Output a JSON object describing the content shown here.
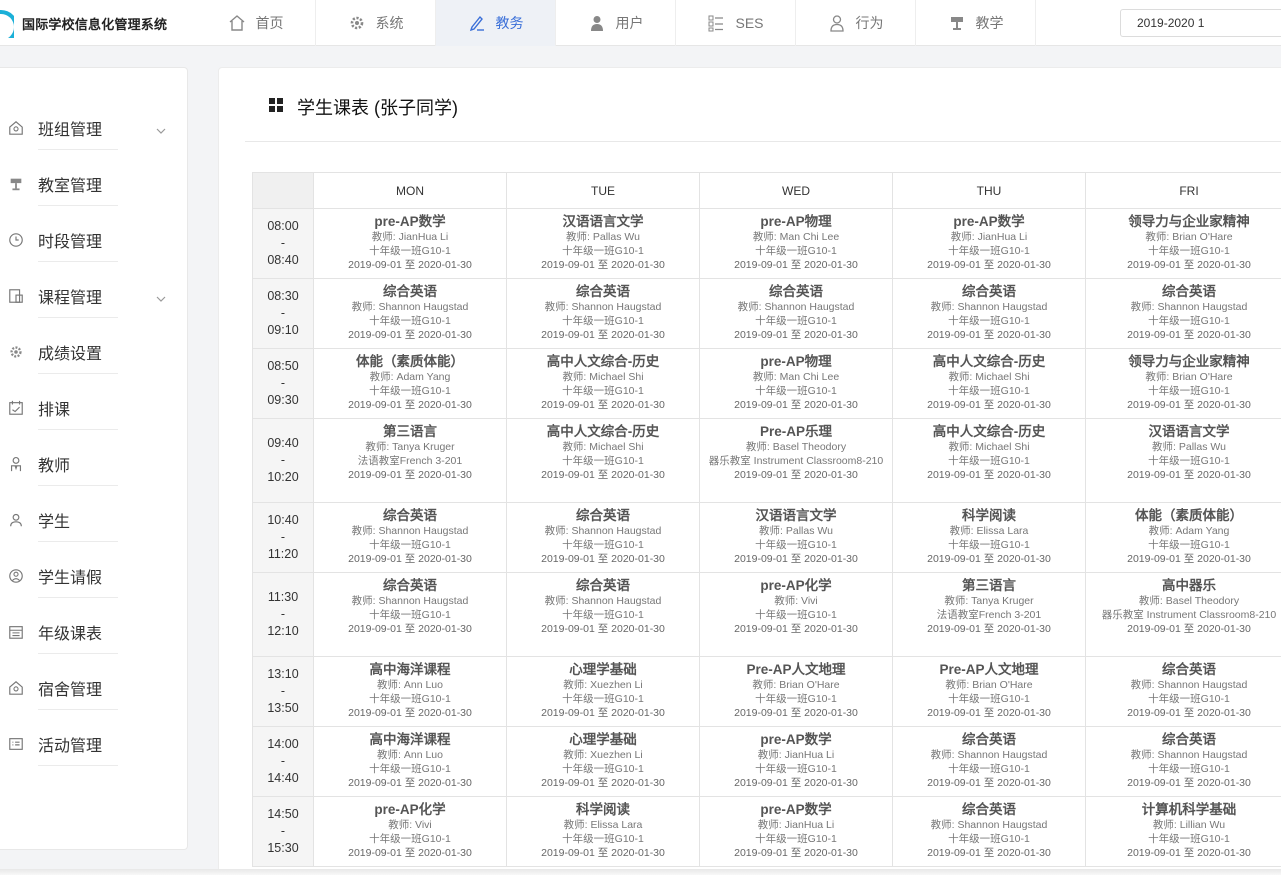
{
  "app": {
    "title": "国际学校信息化管理系统"
  },
  "nav": [
    {
      "label": "首页",
      "icon": "home-icon",
      "active": false
    },
    {
      "label": "系统",
      "icon": "gear-icon",
      "active": false
    },
    {
      "label": "教务",
      "icon": "pen-icon",
      "active": true
    },
    {
      "label": "用户",
      "icon": "user-icon",
      "active": false
    },
    {
      "label": "SES",
      "icon": "checklist-icon",
      "active": false
    },
    {
      "label": "行为",
      "icon": "person-outline-icon",
      "active": false
    },
    {
      "label": "教学",
      "icon": "lamp-icon",
      "active": false
    }
  ],
  "term": {
    "value": "2019-2020 1"
  },
  "sidebar": [
    {
      "label": "班组管理",
      "icon": "home-outline-icon",
      "chevron": true
    },
    {
      "label": "教室管理",
      "icon": "lamp-icon",
      "chevron": false
    },
    {
      "label": "时段管理",
      "icon": "clock-icon",
      "chevron": false
    },
    {
      "label": "课程管理",
      "icon": "book-icon",
      "chevron": true
    },
    {
      "label": "成绩设置",
      "icon": "gear-icon",
      "chevron": false
    },
    {
      "label": "排课",
      "icon": "calendar-icon",
      "chevron": false
    },
    {
      "label": "教师",
      "icon": "teacher-icon",
      "chevron": false
    },
    {
      "label": "学生",
      "icon": "student-icon",
      "chevron": false
    },
    {
      "label": "学生请假",
      "icon": "leave-icon",
      "chevron": false
    },
    {
      "label": "年级课表",
      "icon": "schedule-icon",
      "chevron": false
    },
    {
      "label": "宿舍管理",
      "icon": "dorm-icon",
      "chevron": false
    },
    {
      "label": "活动管理",
      "icon": "activity-icon",
      "chevron": false
    }
  ],
  "card": {
    "title": "学生课表 (张子同学)"
  },
  "timetable": {
    "days": [
      "MON",
      "TUE",
      "WED",
      "THU",
      "FRI"
    ],
    "rows": [
      {
        "start": "08:00",
        "sep": "-",
        "end": "08:40",
        "cells": [
          {
            "name": "pre-AP数学",
            "teacher": "教师: JianHua Li",
            "room": "十年级一班G10-1",
            "date": "2019-09-01 至 2020-01-30"
          },
          {
            "name": "汉语语言文学",
            "teacher": "教师: Pallas Wu",
            "room": "十年级一班G10-1",
            "date": "2019-09-01 至 2020-01-30"
          },
          {
            "name": "pre-AP物理",
            "teacher": "教师: Man Chi Lee",
            "room": "十年级一班G10-1",
            "date": "2019-09-01 至 2020-01-30"
          },
          {
            "name": "pre-AP数学",
            "teacher": "教师: JianHua Li",
            "room": "十年级一班G10-1",
            "date": "2019-09-01 至 2020-01-30"
          },
          {
            "name": "领导力与企业家精神",
            "teacher": "教师: Brian O'Hare",
            "room": "十年级一班G10-1",
            "date": "2019-09-01 至 2020-01-30"
          }
        ]
      },
      {
        "start": "08:30",
        "sep": "-",
        "end": "09:10",
        "cells": [
          {
            "name": "综合英语",
            "teacher": "教师: Shannon Haugstad",
            "room": "十年级一班G10-1",
            "date": "2019-09-01 至 2020-01-30"
          },
          {
            "name": "综合英语",
            "teacher": "教师: Shannon Haugstad",
            "room": "十年级一班G10-1",
            "date": "2019-09-01 至 2020-01-30"
          },
          {
            "name": "综合英语",
            "teacher": "教师: Shannon Haugstad",
            "room": "十年级一班G10-1",
            "date": "2019-09-01 至 2020-01-30"
          },
          {
            "name": "综合英语",
            "teacher": "教师: Shannon Haugstad",
            "room": "十年级一班G10-1",
            "date": "2019-09-01 至 2020-01-30"
          },
          {
            "name": "综合英语",
            "teacher": "教师: Shannon Haugstad",
            "room": "十年级一班G10-1",
            "date": "2019-09-01 至 2020-01-30"
          }
        ]
      },
      {
        "start": "08:50",
        "sep": "-",
        "end": "09:30",
        "cells": [
          {
            "name": "体能（素质体能）",
            "teacher": "教师: Adam Yang",
            "room": "十年级一班G10-1",
            "date": "2019-09-01 至 2020-01-30"
          },
          {
            "name": "高中人文综合-历史",
            "teacher": "教师: Michael Shi",
            "room": "十年级一班G10-1",
            "date": "2019-09-01 至 2020-01-30"
          },
          {
            "name": "pre-AP物理",
            "teacher": "教师: Man Chi Lee",
            "room": "十年级一班G10-1",
            "date": "2019-09-01 至 2020-01-30"
          },
          {
            "name": "高中人文综合-历史",
            "teacher": "教师: Michael Shi",
            "room": "十年级一班G10-1",
            "date": "2019-09-01 至 2020-01-30"
          },
          {
            "name": "领导力与企业家精神",
            "teacher": "教师: Brian O'Hare",
            "room": "十年级一班G10-1",
            "date": "2019-09-01 至 2020-01-30"
          }
        ]
      },
      {
        "start": "09:40",
        "sep": "-",
        "end": "10:20",
        "cells": [
          {
            "name": "第三语言",
            "teacher": "教师: Tanya Kruger",
            "room": "法语教室French 3-201",
            "date": "2019-09-01 至 2020-01-30"
          },
          {
            "name": "高中人文综合-历史",
            "teacher": "教师: Michael Shi",
            "room": "十年级一班G10-1",
            "date": "2019-09-01 至 2020-01-30"
          },
          {
            "name": "Pre-AP乐理",
            "teacher": "教师: Basel Theodory",
            "room": "器乐教室 Instrument Classroom8-210",
            "date": "2019-09-01 至 2020-01-30"
          },
          {
            "name": "高中人文综合-历史",
            "teacher": "教师: Michael Shi",
            "room": "十年级一班G10-1",
            "date": "2019-09-01 至 2020-01-30"
          },
          {
            "name": "汉语语言文学",
            "teacher": "教师: Pallas Wu",
            "room": "十年级一班G10-1",
            "date": "2019-09-01 至 2020-01-30"
          }
        ]
      },
      {
        "start": "10:40",
        "sep": "-",
        "end": "11:20",
        "cells": [
          {
            "name": "综合英语",
            "teacher": "教师: Shannon Haugstad",
            "room": "十年级一班G10-1",
            "date": "2019-09-01 至 2020-01-30"
          },
          {
            "name": "综合英语",
            "teacher": "教师: Shannon Haugstad",
            "room": "十年级一班G10-1",
            "date": "2019-09-01 至 2020-01-30"
          },
          {
            "name": "汉语语言文学",
            "teacher": "教师: Pallas Wu",
            "room": "十年级一班G10-1",
            "date": "2019-09-01 至 2020-01-30"
          },
          {
            "name": "科学阅读",
            "teacher": "教师: Elissa Lara",
            "room": "十年级一班G10-1",
            "date": "2019-09-01 至 2020-01-30"
          },
          {
            "name": "体能（素质体能）",
            "teacher": "教师: Adam Yang",
            "room": "十年级一班G10-1",
            "date": "2019-09-01 至 2020-01-30"
          }
        ]
      },
      {
        "start": "11:30",
        "sep": "-",
        "end": "12:10",
        "cells": [
          {
            "name": "综合英语",
            "teacher": "教师: Shannon Haugstad",
            "room": "十年级一班G10-1",
            "date": "2019-09-01 至 2020-01-30"
          },
          {
            "name": "综合英语",
            "teacher": "教师: Shannon Haugstad",
            "room": "十年级一班G10-1",
            "date": "2019-09-01 至 2020-01-30"
          },
          {
            "name": "pre-AP化学",
            "teacher": "教师: Vivi",
            "room": "十年级一班G10-1",
            "date": "2019-09-01 至 2020-01-30"
          },
          {
            "name": "第三语言",
            "teacher": "教师: Tanya Kruger",
            "room": "法语教室French 3-201",
            "date": "2019-09-01 至 2020-01-30"
          },
          {
            "name": "高中器乐",
            "teacher": "教师: Basel Theodory",
            "room": "器乐教室 Instrument Classroom8-210",
            "date": "2019-09-01 至 2020-01-30"
          }
        ]
      },
      {
        "start": "13:10",
        "sep": "-",
        "end": "13:50",
        "cells": [
          {
            "name": "高中海洋课程",
            "teacher": "教师: Ann Luo",
            "room": "十年级一班G10-1",
            "date": "2019-09-01 至 2020-01-30"
          },
          {
            "name": "心理学基础",
            "teacher": "教师: Xuezhen Li",
            "room": "十年级一班G10-1",
            "date": "2019-09-01 至 2020-01-30"
          },
          {
            "name": "Pre-AP人文地理",
            "teacher": "教师: Brian O'Hare",
            "room": "十年级一班G10-1",
            "date": "2019-09-01 至 2020-01-30"
          },
          {
            "name": "Pre-AP人文地理",
            "teacher": "教师: Brian O'Hare",
            "room": "十年级一班G10-1",
            "date": "2019-09-01 至 2020-01-30"
          },
          {
            "name": "综合英语",
            "teacher": "教师: Shannon Haugstad",
            "room": "十年级一班G10-1",
            "date": "2019-09-01 至 2020-01-30"
          }
        ]
      },
      {
        "start": "14:00",
        "sep": "-",
        "end": "14:40",
        "cells": [
          {
            "name": "高中海洋课程",
            "teacher": "教师: Ann Luo",
            "room": "十年级一班G10-1",
            "date": "2019-09-01 至 2020-01-30"
          },
          {
            "name": "心理学基础",
            "teacher": "教师: Xuezhen Li",
            "room": "十年级一班G10-1",
            "date": "2019-09-01 至 2020-01-30"
          },
          {
            "name": "pre-AP数学",
            "teacher": "教师: JianHua Li",
            "room": "十年级一班G10-1",
            "date": "2019-09-01 至 2020-01-30"
          },
          {
            "name": "综合英语",
            "teacher": "教师: Shannon Haugstad",
            "room": "十年级一班G10-1",
            "date": "2019-09-01 至 2020-01-30"
          },
          {
            "name": "综合英语",
            "teacher": "教师: Shannon Haugstad",
            "room": "十年级一班G10-1",
            "date": "2019-09-01 至 2020-01-30"
          }
        ]
      },
      {
        "start": "14:50",
        "sep": "-",
        "end": "15:30",
        "cells": [
          {
            "name": "pre-AP化学",
            "teacher": "教师: Vivi",
            "room": "十年级一班G10-1",
            "date": "2019-09-01 至 2020-01-30"
          },
          {
            "name": "科学阅读",
            "teacher": "教师: Elissa Lara",
            "room": "十年级一班G10-1",
            "date": "2019-09-01 至 2020-01-30"
          },
          {
            "name": "pre-AP数学",
            "teacher": "教师: JianHua Li",
            "room": "十年级一班G10-1",
            "date": "2019-09-01 至 2020-01-30"
          },
          {
            "name": "综合英语",
            "teacher": "教师: Shannon Haugstad",
            "room": "十年级一班G10-1",
            "date": "2019-09-01 至 2020-01-30"
          },
          {
            "name": "计算机科学基础",
            "teacher": "教师: Lillian Wu",
            "room": "十年级一班G10-1",
            "date": "2019-09-01 至 2020-01-30"
          }
        ]
      }
    ]
  },
  "colors": {
    "accent": "#3a6fd8",
    "logo": "#1bb0d8",
    "nav_active_bg": "#eef1f6"
  }
}
